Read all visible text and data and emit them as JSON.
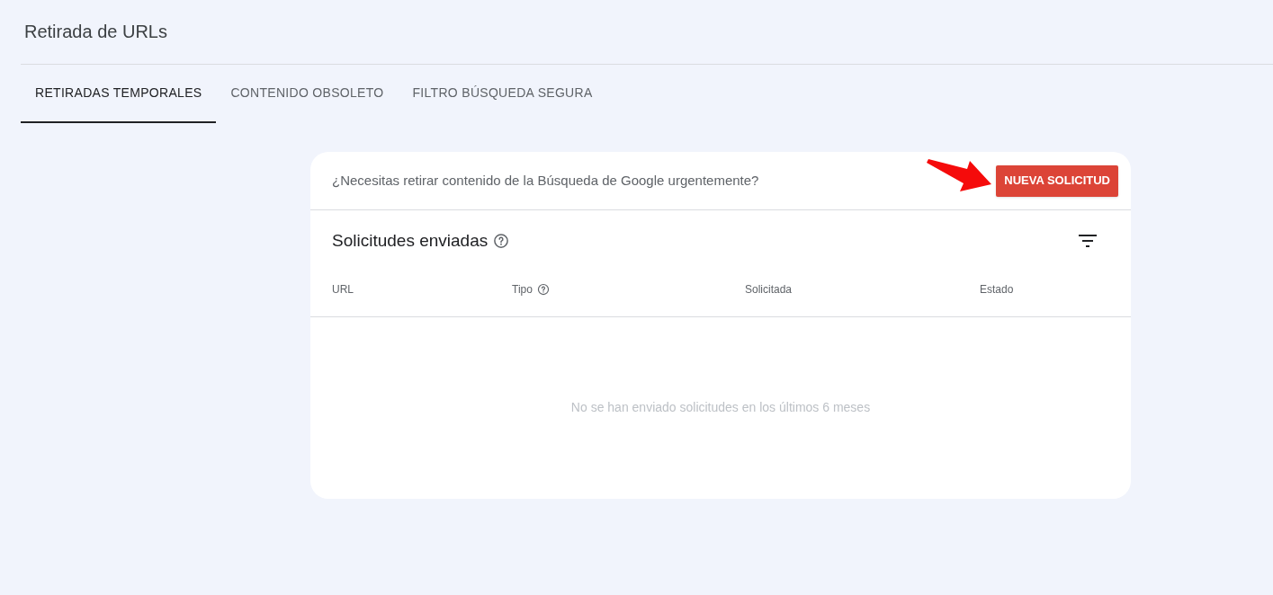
{
  "page": {
    "title": "Retirada de URLs"
  },
  "tabs": [
    {
      "label": "RETIRADAS TEMPORALES",
      "selected": true
    },
    {
      "label": "CONTENIDO OBSOLETO",
      "selected": false
    },
    {
      "label": "FILTRO BÚSQUEDA SEGURA",
      "selected": false
    }
  ],
  "banner": {
    "text": "¿Necesitas retirar contenido de la Búsqueda de Google urgentemente?",
    "button": "NUEVA SOLICITUD"
  },
  "section": {
    "title": "Solicitudes enviadas",
    "help": true
  },
  "table": {
    "columns": [
      {
        "label": "URL",
        "help": false
      },
      {
        "label": "Tipo",
        "help": true
      },
      {
        "label": "Solicitada",
        "help": false
      },
      {
        "label": "Estado",
        "help": false
      }
    ],
    "empty_message": "No se han enviado solicitudes en los últimos 6 meses"
  }
}
